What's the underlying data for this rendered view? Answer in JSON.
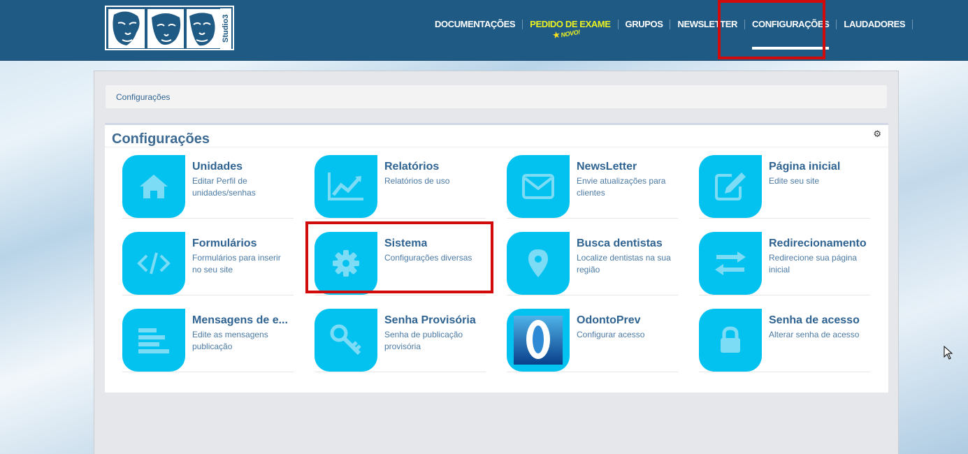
{
  "header": {
    "logo_text": "Studio3",
    "nav": [
      {
        "label": "DOCUMENTAÇÕES",
        "name": "nav-documentacoes"
      },
      {
        "label": "PEDIDO DE EXAME",
        "name": "nav-pedido-de-exame",
        "badge": "NOVO!"
      },
      {
        "label": "GRUPOS",
        "name": "nav-grupos"
      },
      {
        "label": "NEWSLETTER",
        "name": "nav-newsletter"
      },
      {
        "label": "CONFIGURAÇÕES",
        "name": "nav-configuracoes",
        "active": true
      },
      {
        "label": "LAUDADORES",
        "name": "nav-laudadores"
      }
    ]
  },
  "breadcrumb": {
    "label": "Configurações"
  },
  "card": {
    "title": "Configurações",
    "gear_icon": "gear-icon"
  },
  "tiles": [
    {
      "name": "Unidades",
      "desc": "Editar Perfil de unidades/senhas",
      "icon": "home-icon"
    },
    {
      "name": "Relatórios",
      "desc": "Relatórios de uso",
      "icon": "line-chart-icon"
    },
    {
      "name": "NewsLetter",
      "desc": "Envie atualizações para clientes",
      "icon": "envelope-icon"
    },
    {
      "name": "Página inicial",
      "desc": "Edite seu site",
      "icon": "edit-icon"
    },
    {
      "name": "Formulários",
      "desc": "Formulários para inserir no seu site",
      "icon": "code-icon"
    },
    {
      "name": "Sistema",
      "desc": "Configurações diversas",
      "icon": "gear-icon"
    },
    {
      "name": "Busca dentistas",
      "desc": "Localize dentistas na sua região",
      "icon": "map-marker-icon"
    },
    {
      "name": "Redirecionamento",
      "desc": "Redirecione sua página inicial",
      "icon": "exchange-icon"
    },
    {
      "name": "Mensagens de e...",
      "desc": "Edite as mensagens publicação",
      "icon": "align-left-icon"
    },
    {
      "name": "Senha Provisória",
      "desc": "Senha de publicação provisória",
      "icon": "key-icon"
    },
    {
      "name": "OdontoPrev",
      "desc": "Configurar acesso",
      "icon": "odontoprev-logo"
    },
    {
      "name": "Senha de acesso",
      "desc": "Alterar senha de acesso",
      "icon": "lock-icon"
    }
  ],
  "colors": {
    "header": "#1f5a85",
    "tile_icon": "#03c2ef",
    "highlight": "#d10b0b",
    "exam_nav": "#ecf21f"
  }
}
